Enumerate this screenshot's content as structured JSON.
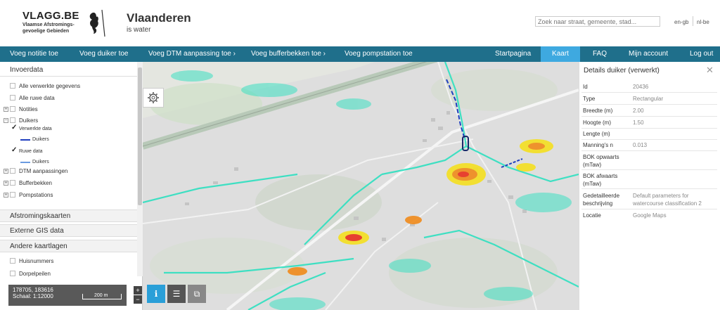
{
  "header": {
    "vlagg_title": "VLAGG.BE",
    "vlagg_sub1": "Vlaamse Afstromings-",
    "vlagg_sub2": "gevoelige Gebieden",
    "vl_title": "Vlaanderen",
    "vl_sub": "is water",
    "search_placeholder": "Zoek naar straat, gemeente, stad...",
    "lang_en": "en-gb",
    "lang_nl": "nl-be"
  },
  "nav": {
    "items": [
      {
        "label": "Voeg notitie toe"
      },
      {
        "label": "Voeg duiker toe"
      },
      {
        "label": "Voeg DTM aanpassing toe ›"
      },
      {
        "label": "Voeg bufferbekken toe ›"
      },
      {
        "label": "Voeg pompstation toe"
      },
      {
        "label": "Startpagina"
      },
      {
        "label": "Kaart"
      },
      {
        "label": "FAQ"
      },
      {
        "label": "Mijn account"
      },
      {
        "label": "Log out"
      }
    ],
    "active_color": "#3ea9e0",
    "bar_color": "#1f6f8b"
  },
  "sidebar": {
    "invoerdata": "Invoerdata",
    "alle_verwerkte": "Alle verwerkte gegevens",
    "alle_ruwe": "Alle ruwe data",
    "notities": "Notities",
    "duikers": "Duikers",
    "verwerkte_data": "Verwerkte data",
    "duikers_legend1": "Duikers",
    "ruwe_data": "Ruwe data",
    "duikers_legend2": "Duikers",
    "dtm": "DTM aanpassingen",
    "bufferbekken": "Bufferbekken",
    "pompstations": "Pompstations",
    "afstromingskaarten": "Afstromingskaarten",
    "externe_gis": "Externe GIS data",
    "andere_kaartlagen": "Andere kaartlagen",
    "huisnummers": "Huisnummers",
    "dorpelpeilen": "Dorpelpeilen",
    "processed_line_color": "#1f3fbf",
    "raw_line_color": "#6a9be0"
  },
  "map": {
    "coords": "178705, 183616",
    "scale": "Schaal: 1:12000",
    "scalebar_label": "200 m",
    "zoom_in": "+",
    "zoom_out": "−",
    "btn_info_icon": "info-icon",
    "btn_list_icon": "list-icon",
    "btn_layers_icon": "layers-icon"
  },
  "details": {
    "title": "Details duiker (verwerkt)",
    "rows": [
      {
        "label": "Id",
        "value": "20436"
      },
      {
        "label": "Type",
        "value": "Rectangular"
      },
      {
        "label": "Breedte (m)",
        "value": "2.00"
      },
      {
        "label": "Hoogte (m)",
        "value": "1.50"
      },
      {
        "label": "Lengte (m)",
        "value": ""
      },
      {
        "label": "Manning's n",
        "value": "0.013"
      },
      {
        "label": "BOK opwaarts (mTaw)",
        "value": ""
      },
      {
        "label": "BOK afwaarts (mTaw)",
        "value": ""
      },
      {
        "label": "Gedetailleerde beschrijving",
        "value": "Default parameters for watercourse classification 2"
      },
      {
        "label": "Locatie",
        "value": "Google Maps"
      }
    ]
  }
}
